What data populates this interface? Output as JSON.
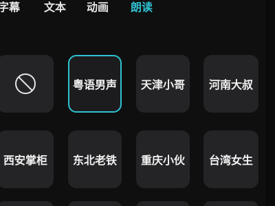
{
  "tabs": [
    {
      "label": "字幕",
      "active": false
    },
    {
      "label": "文本",
      "active": false
    },
    {
      "label": "动画",
      "active": false
    },
    {
      "label": "朗读",
      "active": true
    }
  ],
  "voices": {
    "row1": [
      {
        "label": "",
        "icon": "none-icon"
      },
      {
        "label": "粤语男声",
        "selected": true
      },
      {
        "label": "天津小哥"
      },
      {
        "label": "河南大叔"
      }
    ],
    "row2": [
      {
        "label": "西安掌柜"
      },
      {
        "label": "东北老铁"
      },
      {
        "label": "重庆小伙"
      },
      {
        "label": "台湾女生"
      }
    ]
  },
  "colors": {
    "accent": "#2fc3d2",
    "tile": "#242426",
    "background": "#0f0f10"
  }
}
